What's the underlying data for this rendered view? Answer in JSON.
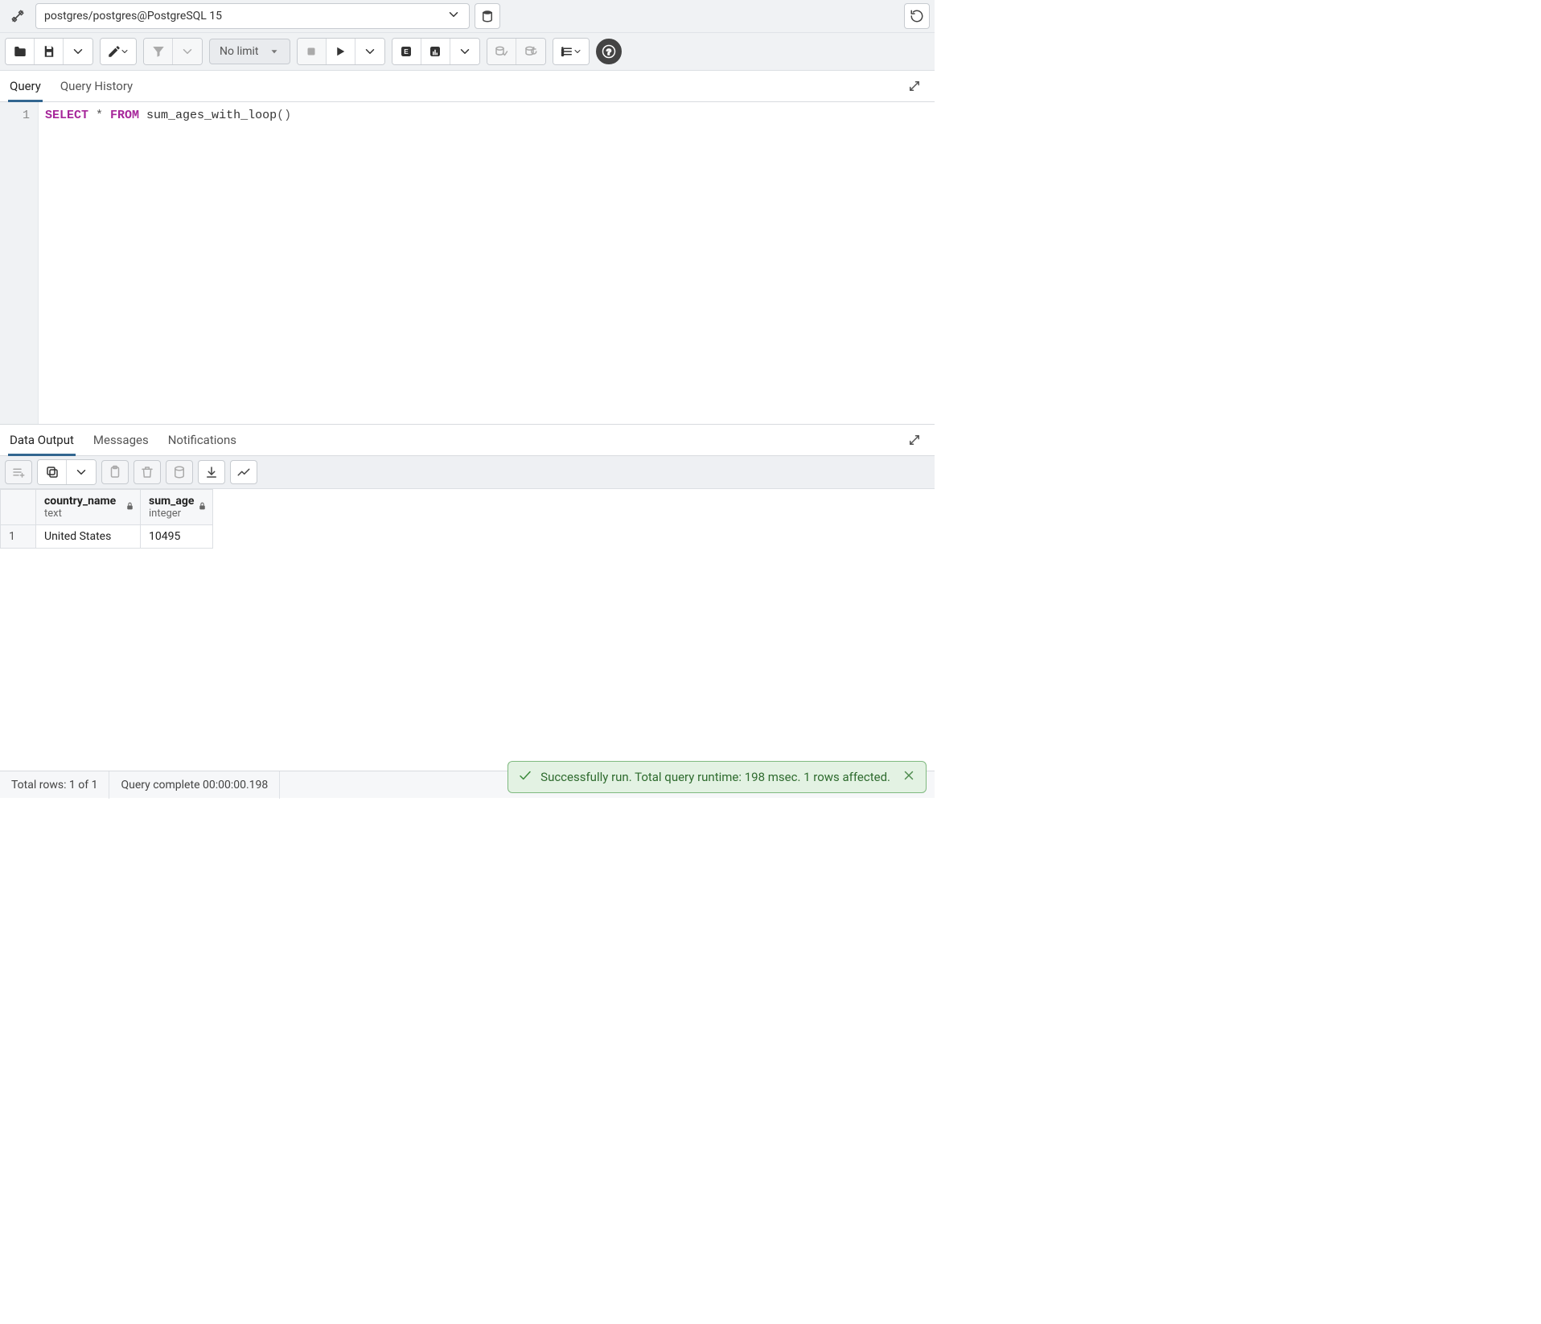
{
  "connection": {
    "label": "postgres/postgres@PostgreSQL 15"
  },
  "toolbar": {
    "limit_label": "No limit"
  },
  "query_tabs": {
    "tabs": [
      "Query",
      "Query History"
    ],
    "active_index": 0
  },
  "editor": {
    "lines": [
      {
        "num": "1",
        "tokens": [
          {
            "t": "kw",
            "v": "SELECT"
          },
          {
            "t": "op",
            "v": " * "
          },
          {
            "t": "kw",
            "v": "FROM"
          },
          {
            "t": "fn",
            "v": " sum_ages_with_loop"
          },
          {
            "t": "op",
            "v": "()"
          }
        ]
      }
    ]
  },
  "output_tabs": {
    "tabs": [
      "Data Output",
      "Messages",
      "Notifications"
    ],
    "active_index": 0
  },
  "result": {
    "columns": [
      {
        "name": "country_name",
        "type": "text",
        "locked": true
      },
      {
        "name": "sum_age",
        "type": "integer",
        "locked": true,
        "numeric": true
      }
    ],
    "rows": [
      {
        "n": "1",
        "cells": [
          "United States",
          "10495"
        ]
      }
    ]
  },
  "status": {
    "total_rows": "Total rows: 1 of 1",
    "query_complete": "Query complete 00:00:00.198"
  },
  "toast": {
    "message": "Successfully run. Total query runtime: 198 msec. 1 rows affected."
  }
}
